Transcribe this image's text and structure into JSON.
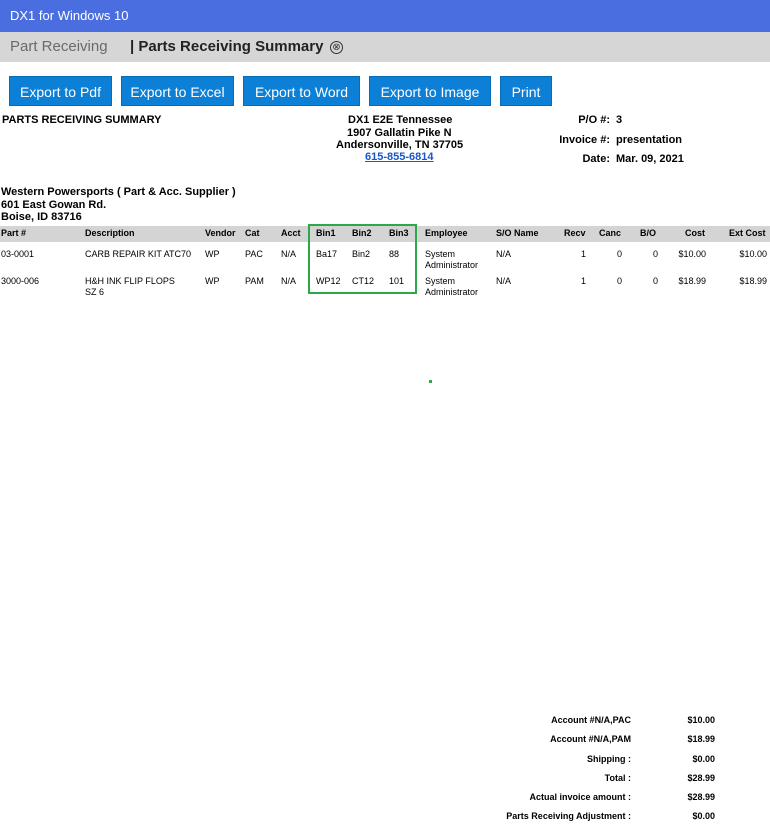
{
  "window": {
    "title": "DX1 for Windows 10"
  },
  "tabs": {
    "inactive": "Part Receiving",
    "active": "| Parts Receiving Summary",
    "close_icon": "⊗"
  },
  "toolbar": {
    "pdf": "Export to Pdf",
    "excel": "Export to Excel",
    "word": "Export to Word",
    "image": "Export to Image",
    "print": "Print"
  },
  "report": {
    "title": "PARTS RECEIVING SUMMARY",
    "dealer": {
      "name": "DX1 E2E Tennessee",
      "street": "1907 Gallatin Pike N",
      "city": "Andersonville, TN 37705",
      "phone": "615-855-6814"
    },
    "po_label": "P/O #:",
    "po_value": "3",
    "invoice_label": "Invoice #:",
    "invoice_value": "presentation",
    "date_label": "Date:",
    "date_value": "Mar. 09, 2021",
    "supplier": {
      "name": "Western Powersports ( Part & Acc. Supplier )",
      "street": "601 East Gowan Rd.",
      "city": "Boise, ID 83716"
    }
  },
  "table": {
    "headers": {
      "part": "Part #",
      "description": "Description",
      "vendor": "Vendor",
      "cat": "Cat",
      "acct": "Acct",
      "bin1": "Bin1",
      "bin2": "Bin2",
      "bin3": "Bin3",
      "employee": "Employee",
      "so_name": "S/O Name",
      "recv": "Recv",
      "canc": "Canc",
      "bo": "B/O",
      "cost": "Cost",
      "ext_cost": "Ext Cost"
    },
    "rows": [
      {
        "part": "03-0001",
        "description_1": "CARB REPAIR KIT ATC70",
        "description_2": "",
        "vendor": "WP",
        "cat": "PAC",
        "acct": "N/A",
        "bin1": "Ba17",
        "bin2": "Bin2",
        "bin3": "88",
        "employee_1": "System",
        "employee_2": "Administrator",
        "so_name": "N/A",
        "recv": "1",
        "canc": "0",
        "bo": "0",
        "cost": "$10.00",
        "ext_cost": "$10.00"
      },
      {
        "part": "3000-006",
        "description_1": "H&H INK FLIP FLOPS",
        "description_2": "SZ 6",
        "vendor": "WP",
        "cat": "PAM",
        "acct": "N/A",
        "bin1": "WP12",
        "bin2": "CT12",
        "bin3": "101",
        "employee_1": "System",
        "employee_2": "Administrator",
        "so_name": "N/A",
        "recv": "1",
        "canc": "0",
        "bo": "0",
        "cost": "$18.99",
        "ext_cost": "$18.99"
      }
    ]
  },
  "summary": [
    {
      "label": "Account #N/A,PAC",
      "value": "$10.00"
    },
    {
      "label": "Account #N/A,PAM",
      "value": "$18.99"
    },
    {
      "label": "Shipping :",
      "value": "$0.00"
    },
    {
      "label": "Total :",
      "value": "$28.99"
    },
    {
      "label": "Actual invoice amount :",
      "value": "$28.99"
    },
    {
      "label": "Parts Receiving Adjustment :",
      "value": "$0.00"
    }
  ],
  "colors": {
    "titlebar": "#4a6ee0",
    "button": "#0c7fd6",
    "highlight": "#2aa84a"
  }
}
